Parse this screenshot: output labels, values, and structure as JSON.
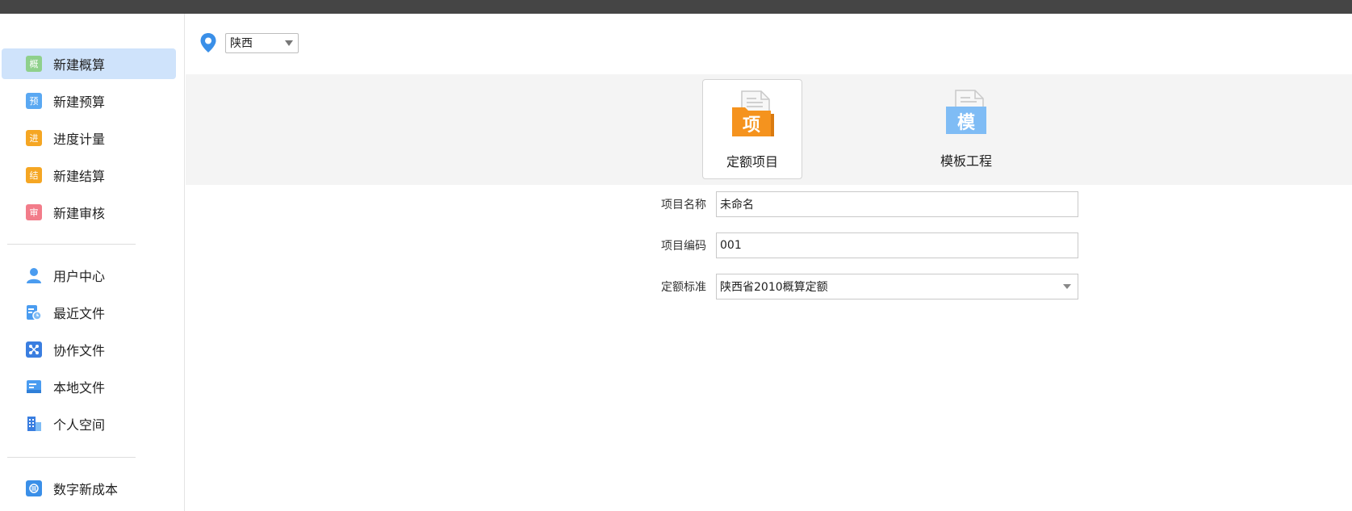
{
  "sidebar": {
    "items": [
      {
        "label": "新建概算",
        "icon": "概",
        "color": "#7dc67a"
      },
      {
        "label": "新建预算",
        "icon": "预",
        "color": "#4a9cf0"
      },
      {
        "label": "进度计量",
        "icon": "进",
        "color": "#f5a623"
      },
      {
        "label": "新建结算",
        "icon": "结",
        "color": "#f5a623"
      },
      {
        "label": "新建审核",
        "icon": "审",
        "color": "#f06a7a"
      },
      {
        "label": "用户中心",
        "icon": "user-icon",
        "color": "#4a9cf0"
      },
      {
        "label": "最近文件",
        "icon": "recent-file-icon",
        "color": "#4a9cf0"
      },
      {
        "label": "协作文件",
        "icon": "collab-file-icon",
        "color": "#3a7ee0"
      },
      {
        "label": "本地文件",
        "icon": "local-file-icon",
        "color": "#4a9cf0"
      },
      {
        "label": "个人空间",
        "icon": "personal-space-icon",
        "color": "#3a7ee0"
      },
      {
        "label": "数字新成本",
        "icon": "digital-cost-icon",
        "color": "#3a8fe8"
      }
    ]
  },
  "region": {
    "value": "陕西"
  },
  "project_types": [
    {
      "label": "定额项目",
      "glyph": "项",
      "color": "#f5931e"
    },
    {
      "label": "模板工程",
      "glyph": "模",
      "color": "#5aa8f2"
    }
  ],
  "form": {
    "name_label": "项目名称",
    "name_value": "未命名",
    "code_label": "项目编码",
    "code_value": "001",
    "standard_label": "定额标准",
    "standard_value": "陕西省2010概算定额"
  }
}
